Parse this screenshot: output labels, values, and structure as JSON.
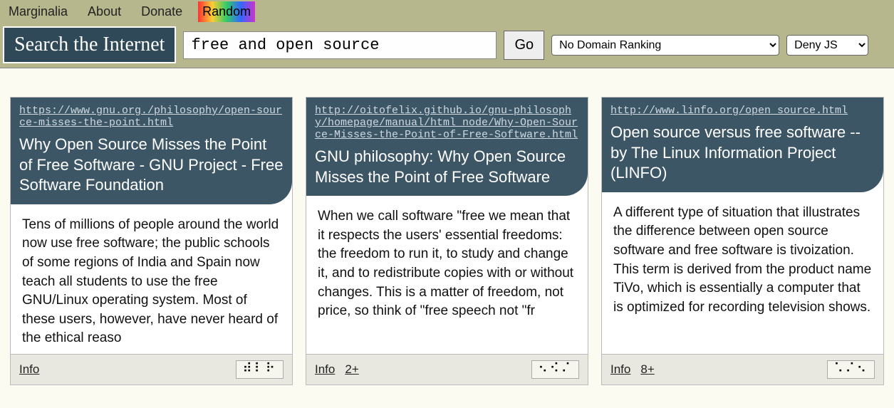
{
  "nav": {
    "items": [
      "Marginalia",
      "About",
      "Donate",
      "Random"
    ]
  },
  "search": {
    "label": "Search the Internet",
    "value": "free and open source",
    "go": "Go",
    "ranking_selected": "No Domain Ranking",
    "js_selected": "Deny JS"
  },
  "results": [
    {
      "url": "https://www.gnu.org./philosophy/open-source-misses-the-point.html",
      "title": "Why Open Source Misses the Point of Free Software - GNU Project - Free Software Foundation",
      "snippet": "Tens of millions of people around the world now use free software; the public schools of some regions of India and Spain now teach all students to use the free GNU/Linux operating system. Most of these users, however, have never heard of the ethical reaso",
      "info": "Info",
      "more": "",
      "dots": "⠾⠇⠗"
    },
    {
      "url": "http://oitofelix.github.io/gnu-philosophy/homepage/manual/html_node/Why-Open-Source-Misses-the-Point-of-Free-Software.html",
      "title": "GNU philosophy: Why Open Source Misses the Point of Free Software",
      "snippet": "When we call software \"free we mean that it respects the users' essential freedoms: the freedom to run it, to study and change it, and to redistribute copies with or without changes. This is a matter of freedom, not price, so think of \"free speech not \"fr",
      "info": "Info",
      "more": "2+",
      "dots": "⠢⠪⠌"
    },
    {
      "url": "http://www.linfo.org/open_source.html",
      "title": "Open source versus free software -- by The Linux Information Project (LINFO)",
      "snippet": "A different type of situation that illustrates the difference between open source software and free software is tivoization. This term is derived from the product name TiVo, which is essentially a computer that is optimized for recording television shows.",
      "info": "Info",
      "more": "8+",
      "dots": "⠡⠌⠢"
    }
  ]
}
